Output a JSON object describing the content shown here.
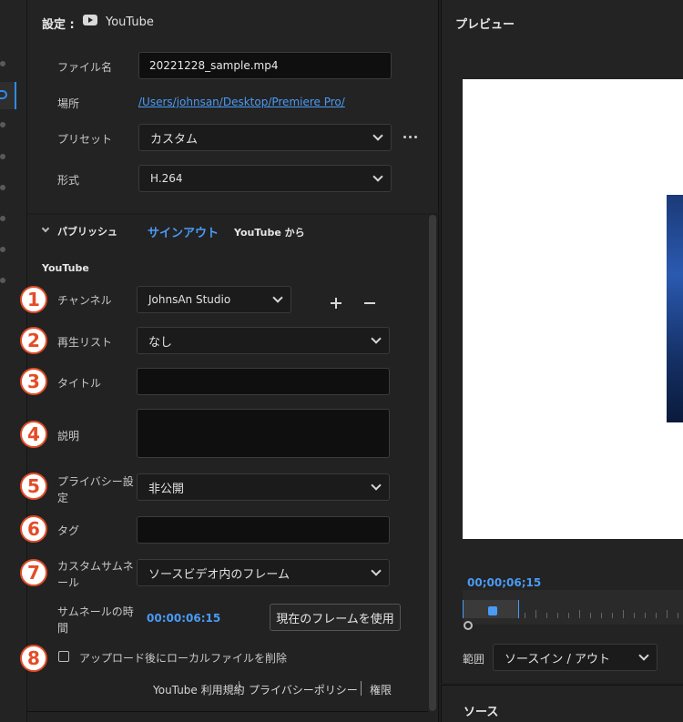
{
  "settings": {
    "title": "設定 :",
    "destination": "YouTube",
    "file_name_label": "ファイル名",
    "file_name_value": "20221228_sample.mp4",
    "location_label": "場所",
    "location_value": "/Users/johnsan/Desktop/Premiere Pro/",
    "preset_label": "プリセット",
    "preset_value": "カスタム",
    "format_label": "形式",
    "format_value": "H.264"
  },
  "publish": {
    "section_title": "パブリッシュ",
    "sign_out": "サインアウト",
    "from_youtube": "YouTube から",
    "group_title": "YouTube",
    "channel_label": "チャンネル",
    "channel_value": "JohnsAn Studio",
    "playlist_label": "再生リスト",
    "playlist_value": "なし",
    "title_label": "タイトル",
    "title_value": "",
    "description_label": "説明",
    "description_value": "",
    "privacy_label_1": "プライバシー設",
    "privacy_label_2": "定",
    "privacy_value": "非公開",
    "tags_label": "タグ",
    "tags_value": "",
    "thumbnail_label_1": "カスタムサムネ",
    "thumbnail_label_2": "ール",
    "thumbnail_value": "ソースビデオ内のフレーム",
    "thumb_time_label_1": "サムネールの時",
    "thumb_time_label_2": "間",
    "thumb_time_value": "00:00:06:15",
    "use_current_frame": "現在のフレームを使用",
    "delete_local_label": "アップロード後にローカルファイルを削除",
    "delete_local_checked": false,
    "footer_links": [
      "YouTube 利用規約",
      "プライバシーポリシー",
      "権限"
    ]
  },
  "markers": [
    "1",
    "2",
    "3",
    "4",
    "5",
    "6",
    "7",
    "8"
  ],
  "preview": {
    "title": "プレビュー",
    "timecode": "00;00;06;15",
    "range_label": "範囲",
    "range_value": "ソースイン / アウト"
  },
  "source": {
    "title": "ソース"
  },
  "colors": {
    "accent_blue": "#2d8ceb",
    "link_blue": "#4a9bf5",
    "marker_red": "#e24d28"
  },
  "icons": {
    "youtube": "play-button-icon",
    "more": "ellipsis-icon",
    "add": "plus-icon",
    "remove": "minus-icon",
    "collapse": "chevron-down-icon"
  }
}
